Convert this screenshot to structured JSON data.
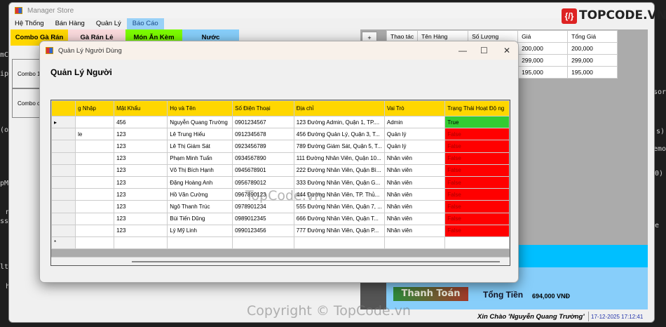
{
  "background_code": [
    "mC",
    "ipM",
    "(ob",
    "pMe",
    "nh",
    "ssa",
    "lt.",
    "hi",
    "s)",
    "sors)",
    "emo",
    "0)",
    "e"
  ],
  "window": {
    "title": "Manager Store"
  },
  "menu": [
    "Hệ Thống",
    "Bán Hàng",
    "Quản Lý",
    "Báo Cáo"
  ],
  "categories": [
    {
      "label": "Combo Gà Rán",
      "color": "#ffd700"
    },
    {
      "label": "Gà Rán Lẻ",
      "color": "#fadadd"
    },
    {
      "label": "Món Ăn Kèm",
      "color": "#7cfc00"
    },
    {
      "label": "Nước",
      "color": "#87cefa"
    }
  ],
  "products": [
    "Combo 1",
    "Combo co"
  ],
  "add_button": "+",
  "cart": {
    "columns": [
      "Thao tác",
      "Tên Hàng",
      "Số Lượng",
      "Giá",
      "Tổng Giá"
    ],
    "rows": [
      [
        "",
        "",
        "",
        "200,000",
        "200,000"
      ],
      [
        "",
        "",
        "",
        "299,000",
        "299,000"
      ],
      [
        "",
        "",
        "",
        "195,000",
        "195,000"
      ]
    ]
  },
  "checkout": {
    "button": "Thanh Toán",
    "total_label": "Tổng Tiền",
    "total_value": "694,000 VNĐ"
  },
  "status": {
    "greeting": "Xin Chào 'Nguyễn Quang Trường'",
    "datetime": "17-12-2025 17:12:41"
  },
  "dialog": {
    "title": "Quản Lý Người Dùng",
    "heading": "Quản Lý Người",
    "columns": [
      "g Nhập",
      "Mật Khẩu",
      "Họ và Tên",
      "Số Điện Thoại",
      "Địa chỉ",
      "Vai Trò",
      "Trạng Thái Hoạt Độ ng"
    ],
    "rows": [
      [
        "",
        "456",
        "Nguyễn Quang Trường",
        "0901234567",
        "123 Đường Admin, Quận 1, TP....",
        "Admin",
        "True"
      ],
      [
        "le",
        "123",
        "Lê Trung Hiếu",
        "0912345678",
        "456 Đường Quản Lý, Quận 3, T...",
        "Quản lý",
        "False"
      ],
      [
        "",
        "123",
        "Lê Thị Giám Sát",
        "0923456789",
        "789 Đường Giám Sát, Quận 5, T...",
        "Quản lý",
        "False"
      ],
      [
        "",
        "123",
        "Phạm Minh Tuấn",
        "0934567890",
        "111 Đường Nhân Viên, Quận 10...",
        "Nhân viên",
        "False"
      ],
      [
        "",
        "123",
        "Võ Thị Bích Hạnh",
        "0945678901",
        "222 Đường Nhân Viên, Quận Bì...",
        "Nhân viên",
        "False"
      ],
      [
        "",
        "123",
        "Đặng Hoàng Anh",
        "0956789012",
        "333 Đường Nhân Viên, Quận G...",
        "Nhân viên",
        "False"
      ],
      [
        "",
        "123",
        "Hồ Văn Cường",
        "0967890123",
        "444 Đường Nhân Viên, TP. Thủ...",
        "Nhân viên",
        "False"
      ],
      [
        "",
        "123",
        "Ngô Thanh Trúc",
        "0978901234",
        "555 Đường Nhân Viên, Quận 7, ...",
        "Nhân viên",
        "False"
      ],
      [
        "",
        "123",
        "Bùi Tiến Dũng",
        "0989012345",
        "666 Đường Nhân Viên, Quận T...",
        "Nhân viên",
        "False"
      ],
      [
        "",
        "123",
        "Lý Mỹ Linh",
        "0990123456",
        "777 Đường Nhân Viên, Quận P...",
        "Nhân viên",
        "False"
      ]
    ]
  },
  "watermarks": {
    "logo": "TOPCODE.VN",
    "center": "TopCode.vn",
    "footer": "Copyright © TopCode.vn"
  }
}
